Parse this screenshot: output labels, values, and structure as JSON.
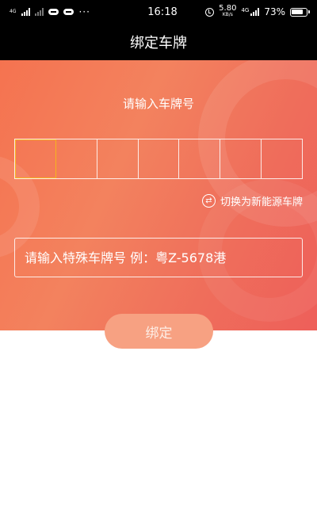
{
  "status_bar": {
    "signal1_label": "4G",
    "time": "16:18",
    "net_speed_value": "5.80",
    "net_speed_unit": "KB/s",
    "network_type": "4G",
    "battery": "73%"
  },
  "header": {
    "title": "绑定车牌"
  },
  "form": {
    "prompt": "请输入车牌号",
    "plate_cells": [
      "",
      "",
      "",
      "",
      "",
      "",
      ""
    ],
    "active_cell_index": 0,
    "switch_label": "切换为新能源车牌",
    "special_placeholder": "请输入特殊车牌号 例：粤Z-5678港",
    "bind_label": "绑定"
  },
  "colors": {
    "gradient_start": "#f57350",
    "gradient_end": "#ee5f5a",
    "active_cell_border": "#f5b41c",
    "button_bg": "#f7a182"
  }
}
